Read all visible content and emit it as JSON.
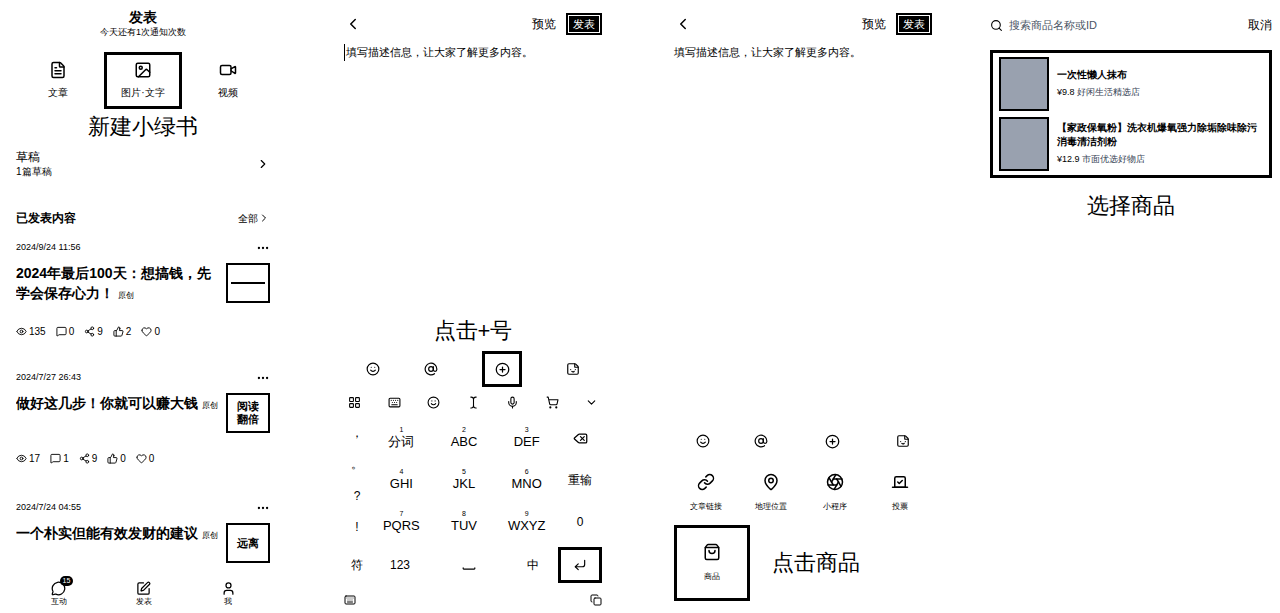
{
  "publish": {
    "title": "发表",
    "subtitle": "今天还有1次通知次数",
    "types": [
      {
        "label": "文章",
        "highlighted": false
      },
      {
        "label": "图片·文字",
        "highlighted": true
      },
      {
        "label": "视频",
        "highlighted": false
      }
    ],
    "annotation": "新建小绿书",
    "drafts": {
      "label": "草稿",
      "count": "1篇草稿"
    },
    "published": {
      "label": "已发表内容",
      "all": "全部"
    },
    "posts": [
      {
        "date": "2024/9/24 11:56",
        "title": "2024年最后100天：想搞钱，先学会保存心力！",
        "tag": "原创",
        "thumb": [],
        "stats": [
          "135",
          "0",
          "9",
          "2",
          "0"
        ]
      },
      {
        "date": "2024/7/27 26:43",
        "title": "做好这几步！你就可以赚大钱",
        "tag": "原创",
        "thumb": [
          "阅读",
          "翻倍"
        ],
        "stats": [
          "17",
          "1",
          "9",
          "0",
          "0"
        ]
      },
      {
        "date": "2024/7/24 04:55",
        "title": "一个朴实但能有效发财的建议",
        "tag": "原创",
        "thumb": [
          "远离"
        ],
        "stats": []
      }
    ],
    "nav": [
      {
        "label": "互动",
        "badge": "15"
      },
      {
        "label": "发表",
        "badge": ""
      },
      {
        "label": "我",
        "badge": ""
      }
    ]
  },
  "editor_keyboard": {
    "preview": "预览",
    "publish": "发表",
    "placeholder": "填写描述信息，让大家了解更多内容。",
    "annotation": "点击+号",
    "plus_highlighted": true,
    "punctuation": [
      "，",
      "。",
      "?",
      "!"
    ],
    "keys": [
      {
        "num": "1",
        "label": "分词"
      },
      {
        "num": "2",
        "label": "ABC"
      },
      {
        "num": "3",
        "label": "DEF"
      },
      {
        "num": "4",
        "label": "GHI"
      },
      {
        "num": "5",
        "label": "JKL"
      },
      {
        "num": "6",
        "label": "MNO"
      },
      {
        "num": "7",
        "label": "PQRS"
      },
      {
        "num": "8",
        "label": "TUV"
      },
      {
        "num": "9",
        "label": "WXYZ"
      }
    ],
    "side_keys": [
      "重输",
      "0"
    ],
    "bottom_keys": [
      "符",
      "123",
      "中"
    ],
    "enter_highlighted": true
  },
  "editor_tools": {
    "preview": "预览",
    "publish": "发表",
    "placeholder": "填写描述信息，让大家了解更多内容。",
    "tools": [
      {
        "label": "文章链接",
        "highlighted": false
      },
      {
        "label": "地理位置",
        "highlighted": false
      },
      {
        "label": "小程序",
        "highlighted": false
      },
      {
        "label": "投票",
        "highlighted": false
      },
      {
        "label": "商品",
        "highlighted": true
      }
    ],
    "annotation": "点击商品"
  },
  "product_search": {
    "placeholder": "搜索商品名称或ID",
    "cancel": "取消",
    "products": [
      {
        "name": "一次性懒人抹布",
        "price": "¥9.8",
        "shop": "好闲生活精选店"
      },
      {
        "name": "【家政保氧粉】洗衣机爆氧强力除垢除味除污消毒清洁剂粉",
        "price": "¥12.9",
        "shop": "市面优选好物店"
      }
    ],
    "annotation": "选择商品"
  }
}
